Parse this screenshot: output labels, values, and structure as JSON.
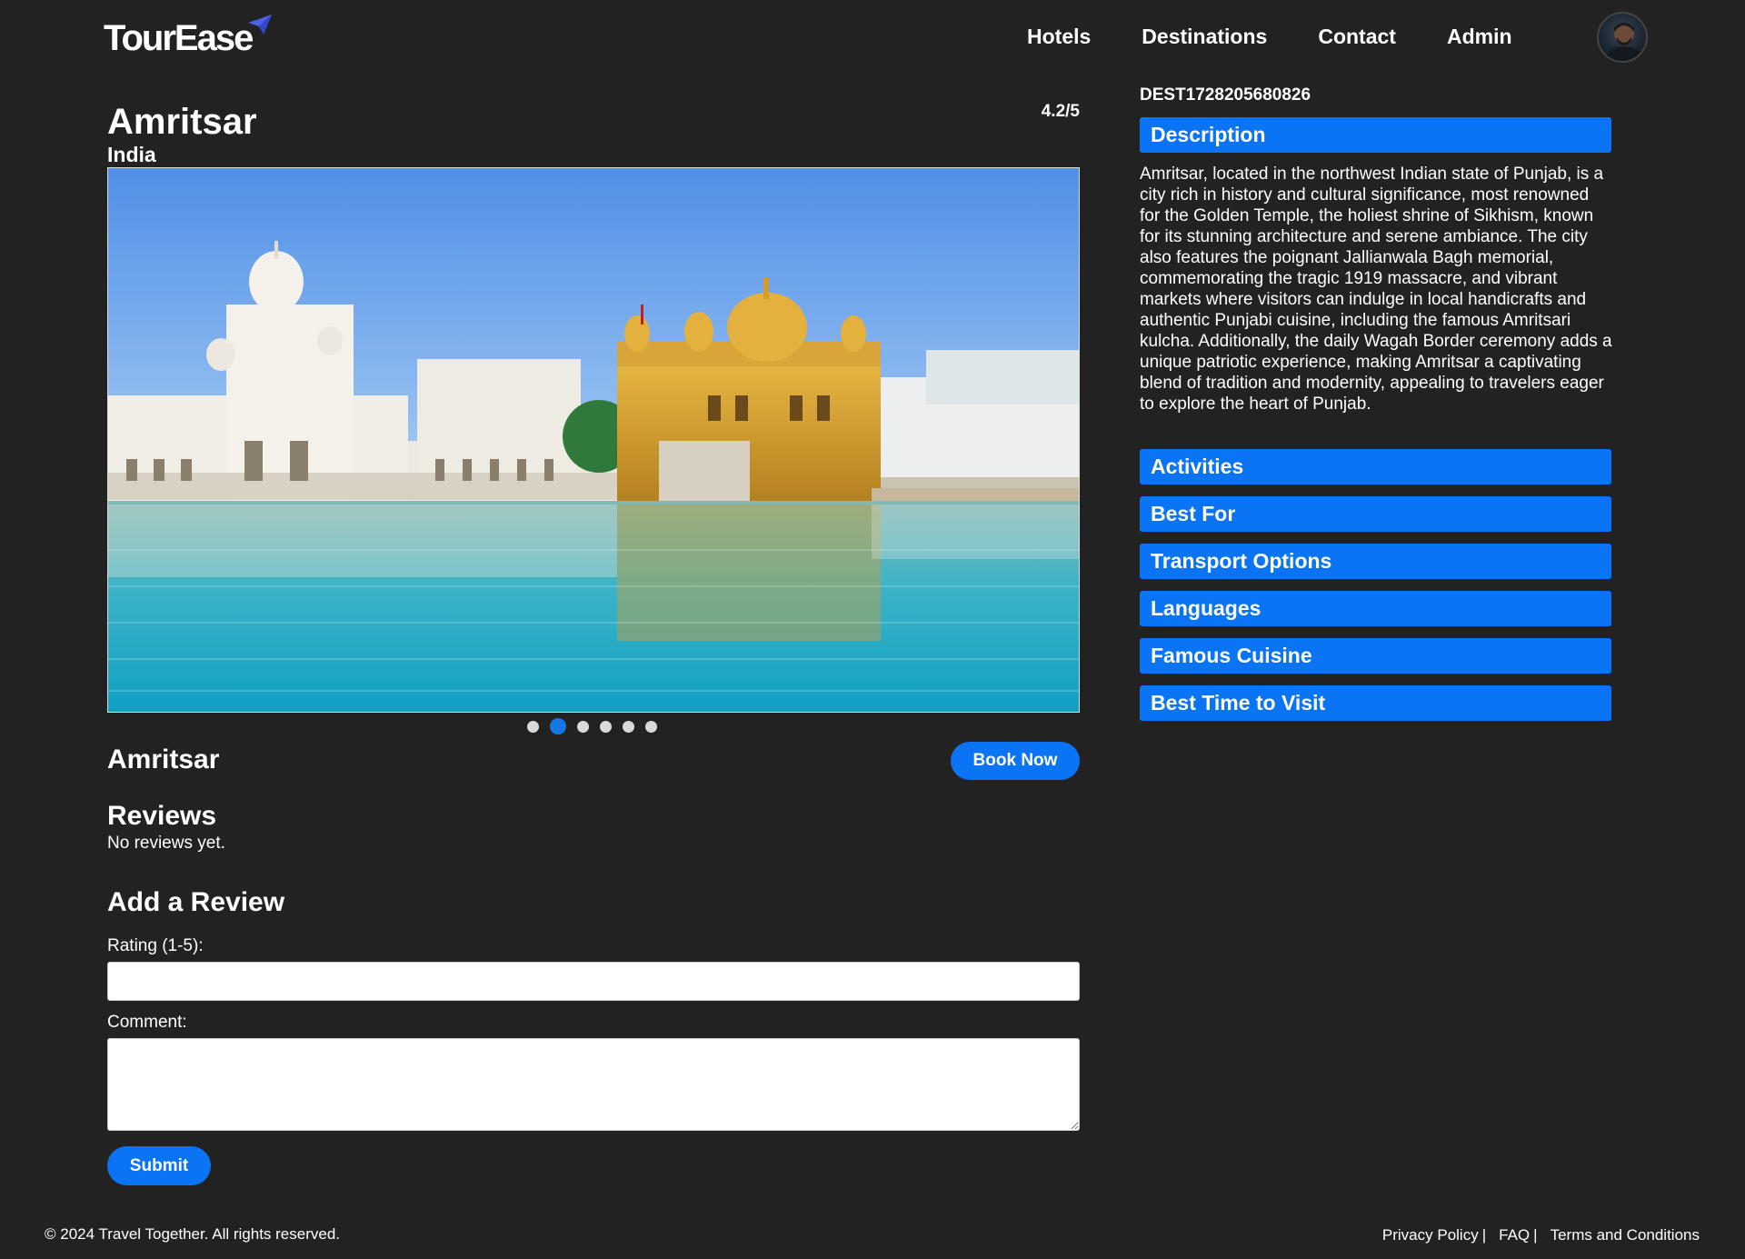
{
  "nav": {
    "logo": "TourEase",
    "links": [
      "Hotels",
      "Destinations",
      "Contact",
      "Admin"
    ]
  },
  "destination": {
    "id": "DEST1728205680826",
    "name": "Amritsar",
    "country": "India",
    "rating": "4.2/5",
    "carousel": {
      "slides": 6,
      "active_slide": 2
    },
    "book_label": "Book Now"
  },
  "sections": {
    "description_label": "Description",
    "description_text": "Amritsar, located in the northwest Indian state of Punjab, is a city rich in history and cultural significance, most renowned for the Golden Temple, the holiest shrine of Sikhism, known for its stunning architecture and serene ambiance. The city also features the poignant Jallianwala Bagh memorial, commemorating the tragic 1919 massacre, and vibrant markets where visitors can indulge in local handicrafts and authentic Punjabi cuisine, including the famous Amritsari kulcha. Additionally, the daily Wagah Border ceremony adds a unique patriotic experience, making Amritsar a captivating blend of tradition and modernity, appealing to travelers eager to explore the heart of Punjab.",
    "activities": "Activities",
    "best_for": "Best For",
    "transport": "Transport Options",
    "languages": "Languages",
    "cuisine": "Famous Cuisine",
    "best_time": "Best Time to Visit"
  },
  "reviews": {
    "heading": "Reviews",
    "empty_text": "No reviews yet.",
    "add_heading": "Add a Review",
    "rating_label": "Rating (1-5):",
    "comment_label": "Comment:",
    "submit_label": "Submit"
  },
  "footer": {
    "copyright": "© 2024 Travel Together. All rights reserved.",
    "privacy": "Privacy Policy",
    "faq": "FAQ",
    "terms": "Terms and Conditions",
    "separator": "|"
  },
  "colors": {
    "background": "#222222",
    "accent": "#0a74f5"
  }
}
